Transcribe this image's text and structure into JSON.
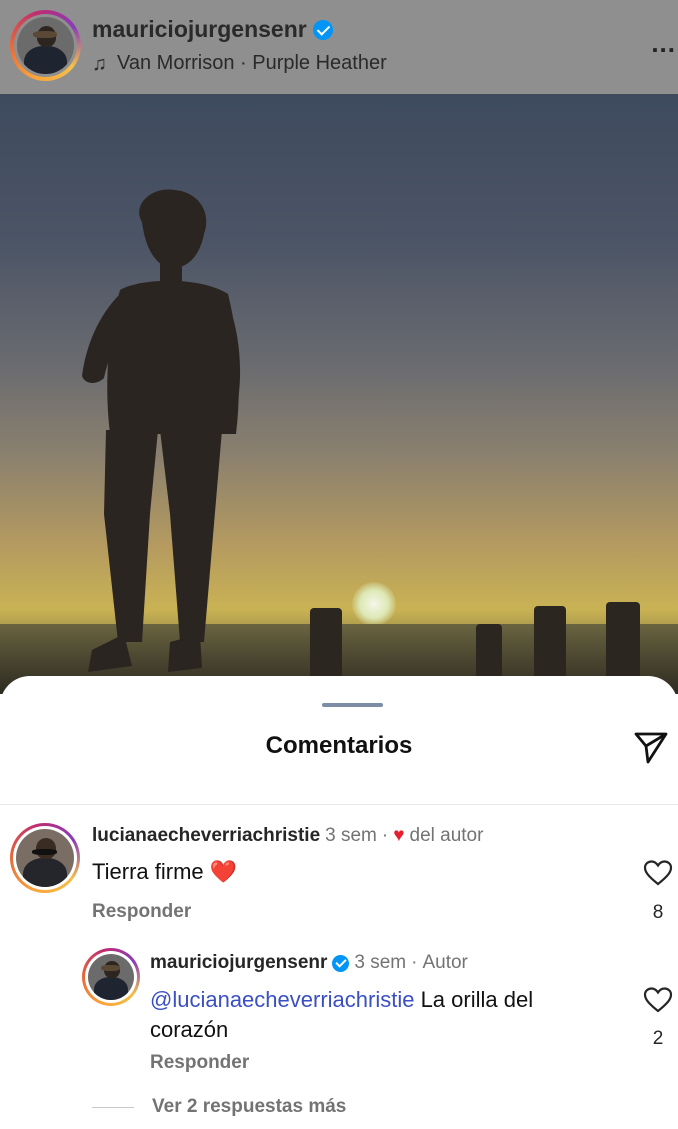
{
  "post": {
    "username": "mauriciojurgensenr",
    "music": "Van Morrison · Purple Heather",
    "more_label": "..."
  },
  "sheet": {
    "title": "Comentarios"
  },
  "comments": [
    {
      "username": "lucianaecheverriachristie",
      "time": "3 sem",
      "separator": "·",
      "badge": "del autor",
      "text": "Tierra firme",
      "emoji": "❤️",
      "reply_label": "Responder",
      "likes": "8"
    },
    {
      "username": "mauriciojurgensenr",
      "time": "3 sem",
      "separator": "·",
      "badge": "Autor",
      "mention": "@lucianaecheverriachristie",
      "text": " La orilla del",
      "text_line2": "corazón",
      "reply_label": "Responder",
      "likes": "2"
    }
  ],
  "more_replies_label": "Ver 2 respuestas más",
  "icons": {
    "verified": "verified-badge-icon",
    "music": "music-note-icon",
    "share": "paper-plane-icon",
    "like": "heart-outline-icon",
    "liked_by_author": "heart-filled-icon"
  },
  "colors": {
    "verified": "#0095f6",
    "mention": "#3b4fc4",
    "heart": "#e5202e",
    "secondary_text": "#737373"
  }
}
